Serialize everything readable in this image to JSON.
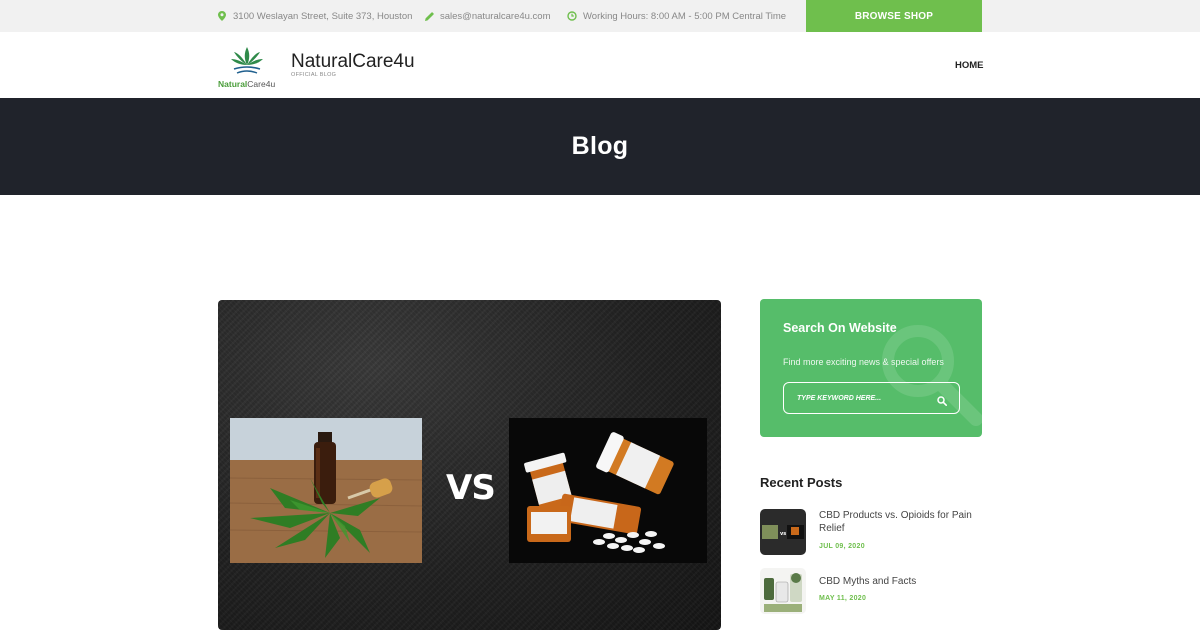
{
  "topbar": {
    "address": "3100 Weslayan Street, Suite 373, Houston",
    "email": "sales@naturalcare4u.com",
    "hours": "Working Hours: 8:00 AM - 5:00 PM Central Time",
    "browse_label": "BROWSE SHOP",
    "icons": [
      "location-pin-icon",
      "pencil-icon",
      "clock-icon"
    ]
  },
  "header": {
    "logo_text_green": "Natural",
    "logo_text_dark": "Care4u",
    "brand_name": "NaturalCare4u",
    "brand_tagline": "OFFICIAL BLOG",
    "nav": [
      {
        "label": "HOME"
      }
    ]
  },
  "hero": {
    "title": "Blog"
  },
  "feature": {
    "vs_text": "VS"
  },
  "sidebar": {
    "search": {
      "title": "Search On Website",
      "subtitle": "Find more exciting news & special offers",
      "placeholder": "TYPE KEYWORD HERE..."
    },
    "recent": {
      "title": "Recent Posts",
      "posts": [
        {
          "title": "CBD Products vs. Opioids for Pain Relief",
          "date": "JUL 09, 2020"
        },
        {
          "title": "CBD Myths and Facts",
          "date": "MAY 11, 2020"
        }
      ]
    }
  },
  "colors": {
    "accent_green": "#6fbf4d",
    "widget_green": "#56bd6a",
    "hero_dark": "#20232b",
    "topbar_bg": "#f1f1f1"
  }
}
